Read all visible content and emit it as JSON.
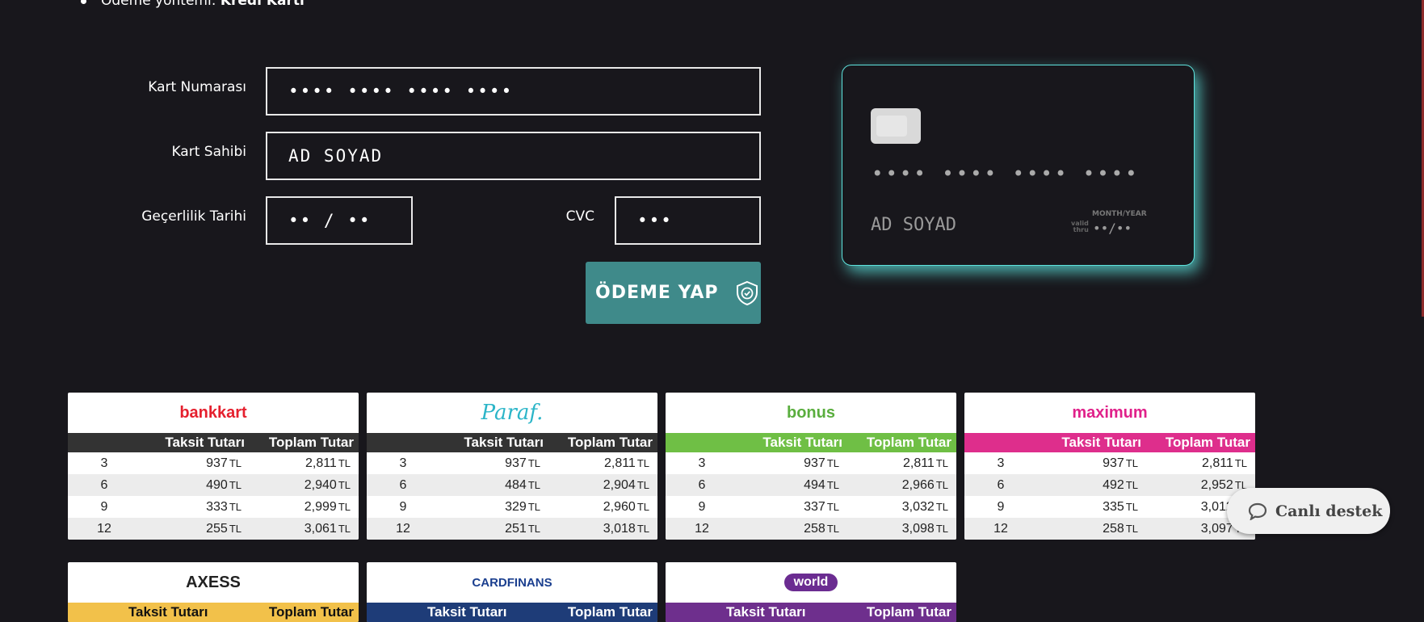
{
  "payment_method": {
    "label": "Ödeme yöntemi:",
    "value": "Kredi Kartı"
  },
  "form": {
    "card_number_label": "Kart Numarası",
    "card_number_placeholder": "•••• •••• •••• ••••",
    "card_holder_label": "Kart Sahibi",
    "card_holder_placeholder": "AD SOYAD",
    "expiry_label": "Geçerlilik Tarihi",
    "expiry_placeholder": "•• / ••",
    "cvc_label": "CVC",
    "cvc_placeholder": "•••",
    "submit_label": "ÖDEME YAP"
  },
  "card_preview": {
    "number": "•••• •••• •••• ••••",
    "name": "AD SOYAD",
    "valid_thru_1": "valid",
    "valid_thru_2": "thru",
    "month_year": "MONTH/YEAR",
    "expiry": "••/••"
  },
  "table_headers": {
    "installment_amount": "Taksit Tutarı",
    "total_amount": "Toplam Tutar",
    "currency": "TL"
  },
  "banks": [
    {
      "name": "bankkart",
      "brand_color": "#e5202e",
      "header_color": "#333333",
      "rows": [
        {
          "n": "3",
          "amt": "937",
          "tot": "2,811"
        },
        {
          "n": "6",
          "amt": "490",
          "tot": "2,940"
        },
        {
          "n": "9",
          "amt": "333",
          "tot": "2,999"
        },
        {
          "n": "12",
          "amt": "255",
          "tot": "3,061"
        }
      ]
    },
    {
      "name": "Paraf.",
      "brand_color": "#2bb5c8",
      "header_color": "#333333",
      "rows": [
        {
          "n": "3",
          "amt": "937",
          "tot": "2,811"
        },
        {
          "n": "6",
          "amt": "484",
          "tot": "2,904"
        },
        {
          "n": "9",
          "amt": "329",
          "tot": "2,960"
        },
        {
          "n": "12",
          "amt": "251",
          "tot": "3,018"
        }
      ]
    },
    {
      "name": "bonus",
      "brand_color": "#5aae3e",
      "header_color": "#6fbf45",
      "rows": [
        {
          "n": "3",
          "amt": "937",
          "tot": "2,811"
        },
        {
          "n": "6",
          "amt": "494",
          "tot": "2,966"
        },
        {
          "n": "9",
          "amt": "337",
          "tot": "3,032"
        },
        {
          "n": "12",
          "amt": "258",
          "tot": "3,098"
        }
      ]
    },
    {
      "name": "maximum",
      "brand_color": "#e0218a",
      "header_color": "#de2e8c",
      "rows": [
        {
          "n": "3",
          "amt": "937",
          "tot": "2,811"
        },
        {
          "n": "6",
          "amt": "492",
          "tot": "2,952"
        },
        {
          "n": "9",
          "amt": "335",
          "tot": "3,012"
        },
        {
          "n": "12",
          "amt": "258",
          "tot": "3,097"
        }
      ]
    },
    {
      "name": "AXESS",
      "brand_color": "#222222",
      "header_color": "#f2c14a",
      "rows": []
    },
    {
      "name": "CARDFINANS",
      "brand_color": "#1b3f8f",
      "header_color": "#1e3c78",
      "rows": []
    },
    {
      "name": "world",
      "brand_color": "#6b2c91",
      "header_color": "#6e2f8d",
      "rows": []
    }
  ],
  "chat": {
    "label": "Canlı destek"
  }
}
